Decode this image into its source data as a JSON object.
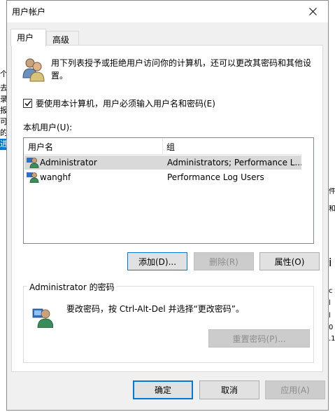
{
  "window": {
    "title": "用户帐户"
  },
  "tabs": [
    {
      "label": "用户"
    },
    {
      "label": "高级"
    }
  ],
  "intro": {
    "text": "用下列表授予或拒绝用户访问你的计算机，还可以更改其密码和其他设置。"
  },
  "require_login": {
    "label": "要使用本计算机，用户必须输入用户名和密码(E)",
    "checked": true
  },
  "users": {
    "label": "本机用户(U):",
    "columns": [
      "用户名",
      "组"
    ],
    "rows": [
      {
        "name": "Administrator",
        "group": "Administrators; Performance L...",
        "selected": true
      },
      {
        "name": "wanghf",
        "group": "Performance Log Users",
        "selected": false
      }
    ]
  },
  "user_buttons": {
    "add": "添加(D)...",
    "remove": "删除(R)",
    "properties": "属性(O)"
  },
  "password_group": {
    "title": "Administrator 的密码",
    "text": "要改密码，按 Ctrl-Alt-Del 并选择“更改密码”。",
    "reset_button": "重置密码(P)..."
  },
  "footer": {
    "ok": "确定",
    "cancel": "取消",
    "apply": "应用(A)"
  },
  "background": {
    "left_chars": [
      "个",
      "去",
      "录",
      "报",
      "可",
      "的",
      "进"
    ],
    "right_chars": [
      "件",
      "和",
      "i",
      "c",
      "l",
      "l",
      "0",
      ".1"
    ]
  },
  "icons": {
    "close": "close-icon",
    "users": "users-icon",
    "user": "user-icon",
    "password": "key-user-icon",
    "check": "check-icon"
  },
  "colors": {
    "accent": "#0078d7",
    "dialog_bg": "#f0f0f0",
    "selection": "#d9d9d9"
  }
}
